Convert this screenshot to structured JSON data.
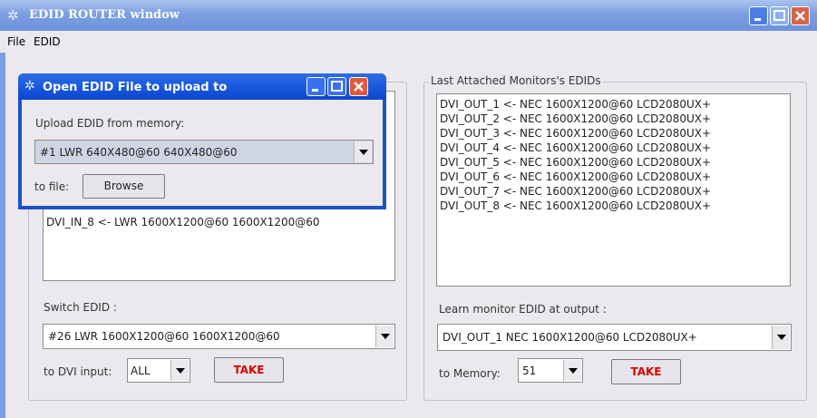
{
  "window": {
    "title": "EDID ROUTER window"
  },
  "menu": [
    "File",
    "EDID"
  ],
  "left_panel": {
    "partial_line": "DVI_IN_8 <- LWR 1600X1200@60 1600X1200@60",
    "switch_label": "Switch EDID :",
    "switch_value": "#26 LWR 1600X1200@60 1600X1200@60",
    "dvi_input_label": "to DVI input:",
    "dvi_input_value": "ALL",
    "take_label": "TAKE"
  },
  "right_panel": {
    "title": "Last Attached Monitors's EDIDs",
    "lines": [
      "DVI_OUT_1 <- NEC 1600X1200@60 LCD2080UX+",
      "DVI_OUT_2 <- NEC 1600X1200@60 LCD2080UX+",
      "DVI_OUT_3 <- NEC 1600X1200@60 LCD2080UX+",
      "DVI_OUT_4 <- NEC 1600X1200@60 LCD2080UX+",
      "DVI_OUT_5 <- NEC 1600X1200@60 LCD2080UX+",
      "DVI_OUT_6 <- NEC 1600X1200@60 LCD2080UX+",
      "DVI_OUT_7 <- NEC 1600X1200@60 LCD2080UX+",
      "DVI_OUT_8 <- NEC 1600X1200@60 LCD2080UX+"
    ],
    "learn_label": "Learn monitor EDID at output :",
    "learn_value": "DVI_OUT_1 NEC 1600X1200@60 LCD2080UX+",
    "memory_label": "to Memory:",
    "memory_value": "51",
    "take_label": "TAKE"
  },
  "dialog": {
    "title": "Open EDID File to upload to",
    "upload_label": "Upload EDID from memory:",
    "upload_value": "#1 LWR 640X480@60 640X480@60",
    "file_label": "to file:",
    "browse_label": "Browse"
  }
}
